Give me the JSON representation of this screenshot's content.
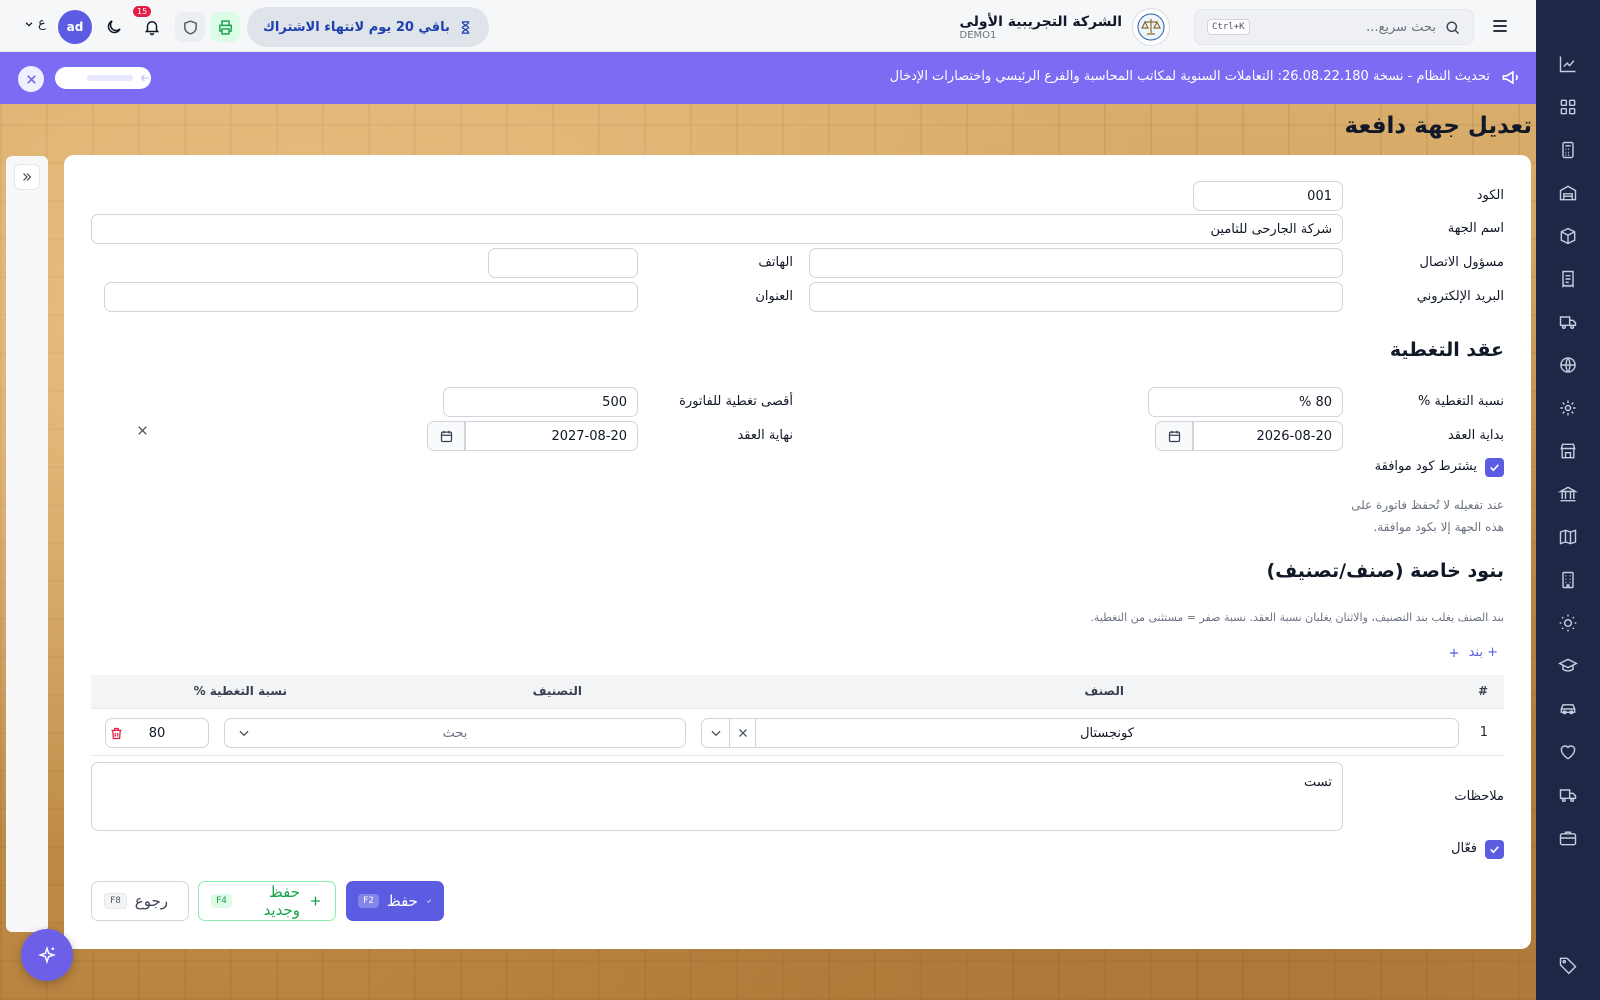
{
  "topbar": {
    "search_placeholder": "بحث سريع...",
    "search_shortcut": "Ctrl+K",
    "company_name": "الشركة التجريبية الأولى",
    "company_code": "DEMO1",
    "trial_text": "باقي 20 يوم لانتهاء الاشتراك",
    "notifications_count": "15",
    "avatar_initials": "ad",
    "language": "ع"
  },
  "announcement": {
    "text": "تحديث النظام - نسخة 26.08.22.180: التعاملات السنوية لمكاتب المحاسبة والفرع الرئيسي واختصارات الإدخال"
  },
  "page": {
    "title": "تعديل جهة دافعة"
  },
  "form": {
    "code_label": "الكود",
    "code_value": "001",
    "name_label": "اسم الجهة",
    "name_value": "شركة الجارحى للتامين",
    "contact_label": "مسؤول الاتصال",
    "contact_value": "",
    "phone_label": "الهاتف",
    "phone_value": "",
    "email_label": "البريد الإلكتروني",
    "email_value": "",
    "address_label": "العنوان",
    "address_value": ""
  },
  "contract": {
    "section_title": "عقد التغطية",
    "coverage_label": "نسبة التغطية %",
    "coverage_value": "80 %",
    "max_label": "أقصى تغطية للفاتورة",
    "max_value": "500",
    "start_label": "بداية العقد",
    "start_value": "2026-08-20",
    "end_label": "نهاية العقد",
    "end_value": "2027-08-20",
    "approval_label": "يشترط كود موافقة",
    "approval_checked": true,
    "approval_help_1": "عند تفعيله لا تُحفظ فاتورة على",
    "approval_help_2": "هذه الجهة إلا بكود موافقة."
  },
  "special": {
    "section_title": "بنود خاصة (صنف/تصنيف)",
    "help": "بند الصنف يغلب بند التصنيف، والاثنان يغلبان نسبة العقد. نسبة صفر = مستثنى من التغطية.",
    "add_label": "+ بند",
    "columns": [
      "#",
      "الصنف",
      "التصنيف",
      "نسبة التغطية %"
    ],
    "rows": [
      {
        "index": "1",
        "item": "كونجستال",
        "category_placeholder": "بحث",
        "coverage": "80"
      }
    ]
  },
  "notes": {
    "label": "ملاحظات",
    "value": "تست"
  },
  "active": {
    "label": "فعّال",
    "checked": true
  },
  "actions": {
    "save_label": "حفظ",
    "save_key": "F2",
    "save_new_label": "حفظ وجديد",
    "save_new_key": "F4",
    "back_label": "رجوع",
    "back_key": "F8"
  },
  "colors": {
    "accent": "#5b5ce2",
    "announce": "#7c6cf3",
    "rail": "#1e2746",
    "danger": "#e11d48",
    "success": "#16a34a"
  }
}
